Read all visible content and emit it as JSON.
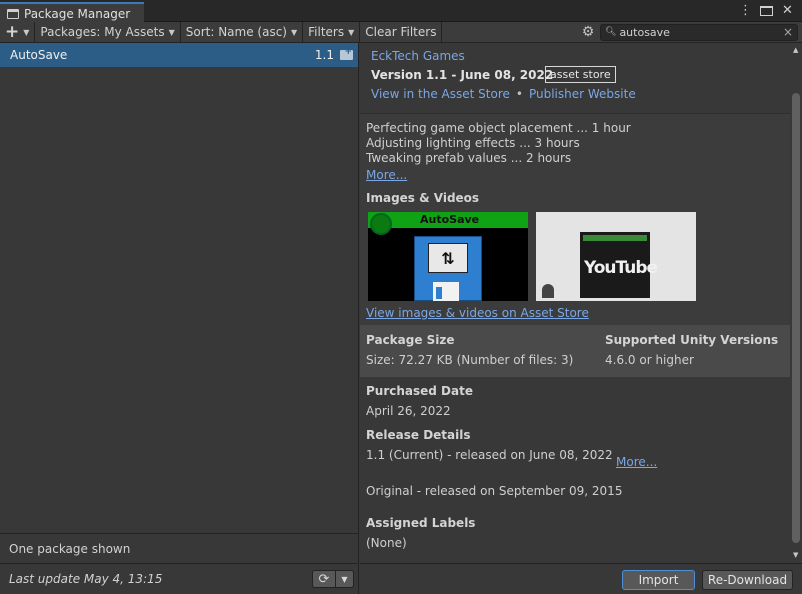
{
  "window": {
    "tab_title": "Package Manager"
  },
  "toolbar": {
    "add_label": "+",
    "packages_label": "Packages: My Assets",
    "sort_label": "Sort: Name (asc)",
    "filters_label": "Filters",
    "clear_filters_label": "Clear Filters",
    "search_value": "autosave"
  },
  "package_list": {
    "items": [
      {
        "name": "AutoSave",
        "version": "1.1"
      }
    ],
    "count_text": "One package shown",
    "last_update": "Last update May 4, 13:15"
  },
  "details": {
    "publisher": "EckTech Games",
    "version_line": "Version 1.1 - June 08, 2022",
    "source_badge": "asset store",
    "link_asset_store": "View in the Asset Store",
    "link_separator": "•",
    "link_publisher": "Publisher Website",
    "description": [
      "Perfecting game object placement ... 1 hour",
      "Adjusting lighting effects ... 3 hours",
      "Tweaking prefab values ... 2 hours"
    ],
    "more_label": "More...",
    "images_title": "Images & Videos",
    "thumb1_text": "AutoSave",
    "thumb2_text": "YouTube",
    "images_link": "View images & videos on Asset Store",
    "package_size_label": "Package Size",
    "package_size_value": "Size: 72.27 KB (Number of files: 3)",
    "unity_versions_label": "Supported Unity Versions",
    "unity_versions_value": "4.6.0 or higher",
    "purchased_label": "Purchased Date",
    "purchased_value": "April 26, 2022",
    "release_label": "Release Details",
    "release_current": "1.1 (Current) - released on June 08, 2022",
    "release_more": "More...",
    "release_original": "Original - released on September 09, 2015",
    "labels_label": "Assigned Labels",
    "labels_value": "(None)"
  },
  "actions": {
    "import_label": "Import",
    "redownload_label": "Re-Download"
  },
  "colors": {
    "accent": "#2c5d87",
    "link": "#7aa7e6",
    "tab_highlight": "#3a79bb"
  }
}
